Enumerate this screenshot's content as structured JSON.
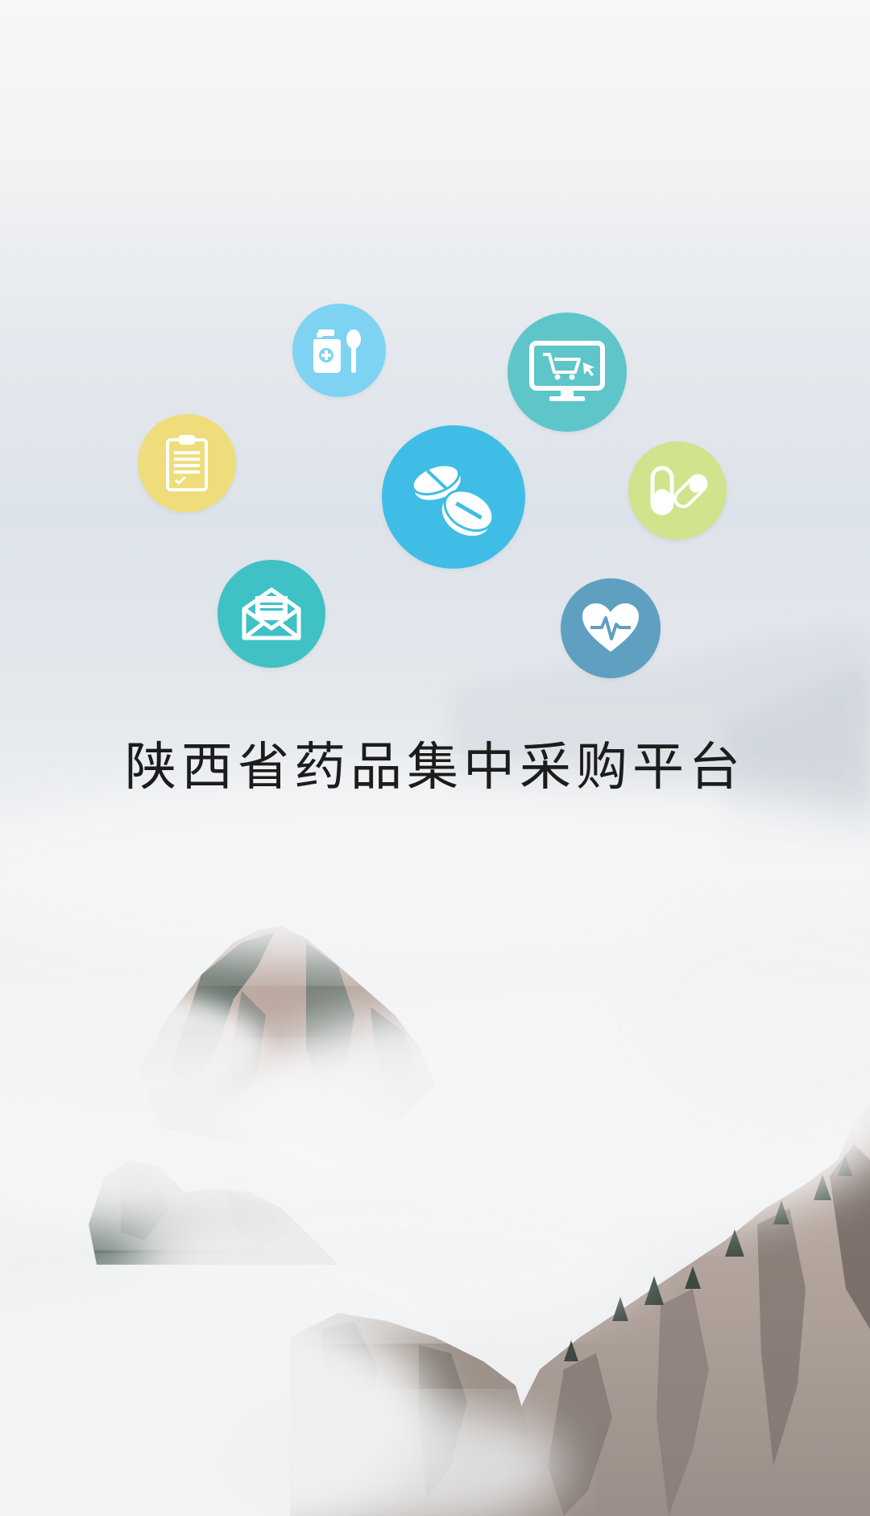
{
  "app": {
    "title": "陕西省药品集中采购平台"
  },
  "icons": [
    {
      "name": "medicine-bottle-icon",
      "color": "#7ed3f2"
    },
    {
      "name": "shopping-cart-monitor-icon",
      "color": "#5ec5c9"
    },
    {
      "name": "clipboard-icon",
      "color": "#eedd7a"
    },
    {
      "name": "pills-icon",
      "color": "#3fbde6"
    },
    {
      "name": "capsule-icon",
      "color": "#cfe48c"
    },
    {
      "name": "envelope-icon",
      "color": "#40c1c5"
    },
    {
      "name": "heart-pulse-icon",
      "color": "#5f9fc0"
    }
  ]
}
